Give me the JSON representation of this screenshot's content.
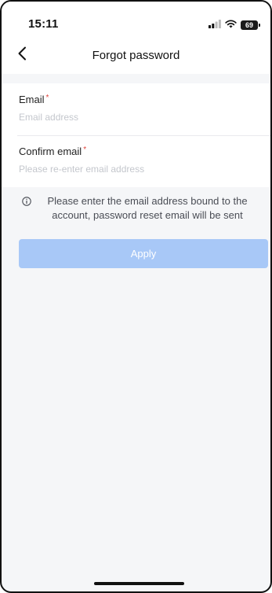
{
  "status_bar": {
    "time": "15:11",
    "battery": "69"
  },
  "nav": {
    "title": "Forgot password",
    "back_icon": "chevron-left-icon"
  },
  "form": {
    "email": {
      "label": "Email",
      "required_mark": "*",
      "value": "",
      "placeholder": "Email address"
    },
    "confirm_email": {
      "label": "Confirm email",
      "required_mark": "*",
      "value": "",
      "placeholder": "Please re-enter email address"
    }
  },
  "hint": {
    "icon": "info-icon",
    "text": "Please enter the email address bound to the account, password reset email will be sent"
  },
  "apply_button": {
    "label": "Apply",
    "state": "disabled"
  },
  "colors": {
    "accent_disabled": "#a8c8f7",
    "required": "#e0443c",
    "background": "#f5f6f8"
  }
}
